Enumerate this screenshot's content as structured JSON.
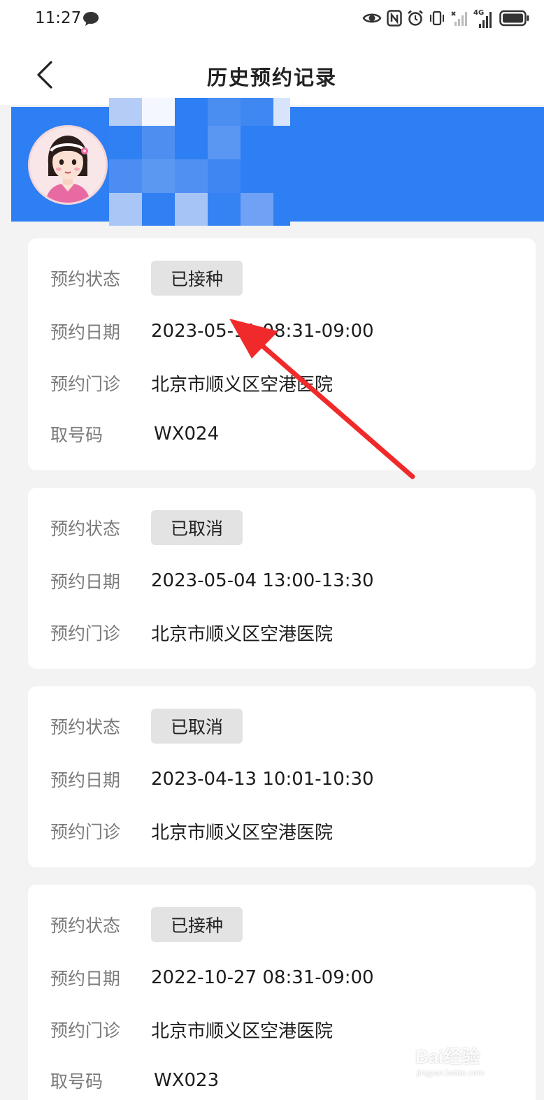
{
  "status_bar": {
    "time": "11:27",
    "network_label": "4G",
    "icons": [
      "message-icon",
      "eye-icon",
      "nfc-icon",
      "alarm-icon",
      "vibrate-icon",
      "no-signal-icon",
      "signal-icon",
      "battery-icon"
    ]
  },
  "nav": {
    "title": "历史预约记录",
    "back_icon": "chevron-left-icon"
  },
  "profile": {
    "avatar": "avatar-girl-illustration",
    "name_obscured": true,
    "banner_color": "#2e7ff3"
  },
  "labels": {
    "status": "预约状态",
    "date": "预约日期",
    "clinic": "预约门诊",
    "number": "取号码"
  },
  "records": [
    {
      "status": "已接种",
      "date": "2023-05-11 08:31-09:00",
      "clinic": "北京市顺义区空港医院",
      "number": "WX024"
    },
    {
      "status": "已取消",
      "date": "2023-05-04 13:00-13:30",
      "clinic": "北京市顺义区空港医院"
    },
    {
      "status": "已取消",
      "date": "2023-04-13 10:01-10:30",
      "clinic": "北京市顺义区空港医院"
    },
    {
      "status": "已接种",
      "date": "2022-10-27 08:31-09:00",
      "clinic": "北京市顺义区空港医院",
      "number": "WX023"
    }
  ],
  "annotation": {
    "type": "red-arrow",
    "color": "#f02a2a",
    "points_to": "records.0.date"
  },
  "watermark": {
    "brand": "Bai经验",
    "url": "jingyan.baidu.com"
  },
  "colors": {
    "accent": "#2e7ff3",
    "badge_bg": "#e3e3e3",
    "page_bg": "#f3f3f3"
  }
}
